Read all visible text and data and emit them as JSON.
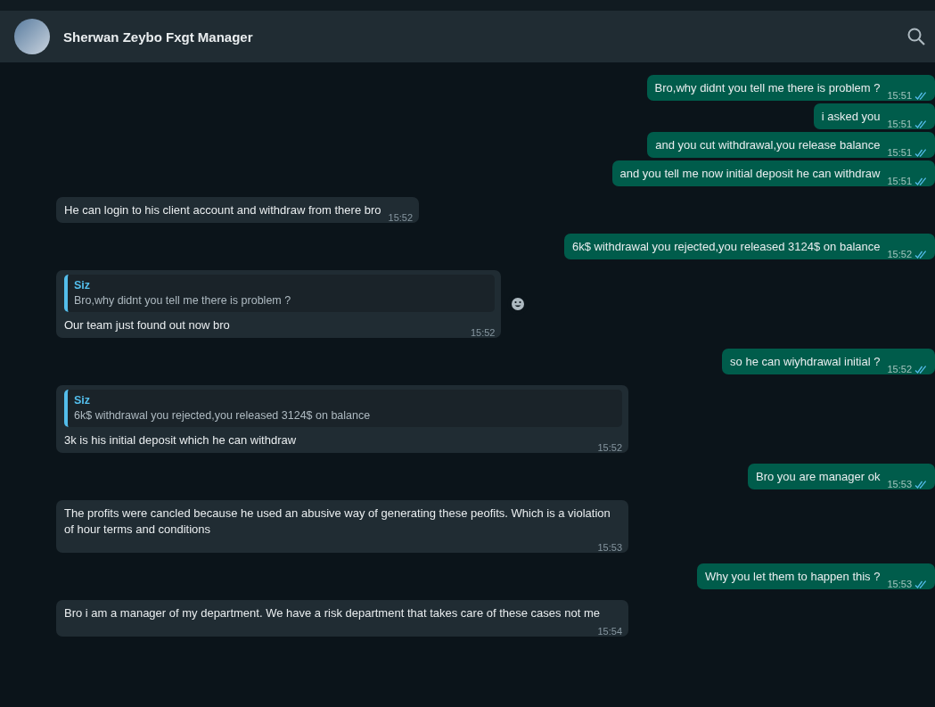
{
  "header": {
    "contact_name": "Sherwan Zeybo Fxgt Manager"
  },
  "messages": [
    {
      "kind": "outgoing",
      "text": "Bro,why didnt you tell me there is problem ?",
      "time": "15:51",
      "read": true
    },
    {
      "kind": "outgoing",
      "text": "i asked you",
      "time": "15:51",
      "read": true
    },
    {
      "kind": "outgoing",
      "text": "and you cut withdrawal,you release balance",
      "time": "15:51",
      "read": true
    },
    {
      "kind": "outgoing",
      "text": "and you tell me now initial deposit he can withdraw",
      "time": "15:51",
      "read": true
    },
    {
      "kind": "incoming",
      "text": "He can login to his client account and withdraw from there bro",
      "time": "15:52"
    },
    {
      "kind": "outgoing",
      "text": "6k$ withdrawal you rejected,you released 3124$ on balance",
      "time": "15:52",
      "read": true
    },
    {
      "kind": "incoming",
      "quote": {
        "author": "Siz",
        "text": "Bro,why didnt you tell me there is problem ?"
      },
      "text": "Our team just found out now bro",
      "time": "15:52",
      "reaction_button": true
    },
    {
      "kind": "outgoing",
      "text": "so he can wiyhdrawal initial ?",
      "time": "15:52",
      "read": true
    },
    {
      "kind": "incoming",
      "quote": {
        "author": "Siz",
        "text": "6k$ withdrawal you rejected,you released 3124$ on balance"
      },
      "text": "3k is his initial deposit which he can withdraw",
      "time": "15:52"
    },
    {
      "kind": "outgoing",
      "text": "Bro you are manager ok",
      "time": "15:53",
      "read": true
    },
    {
      "kind": "incoming",
      "text": "The profits were cancled because he used an abusive way of generating these peofits. Which is a violation of hour terms and conditions",
      "time": "15:53"
    },
    {
      "kind": "outgoing",
      "text": "Why you let them to happen this ?",
      "time": "15:53",
      "read": true
    },
    {
      "kind": "incoming",
      "text": "Bro i am a manager of my department. We have a risk department that takes care of these cases not me",
      "time": "15:54"
    }
  ]
}
